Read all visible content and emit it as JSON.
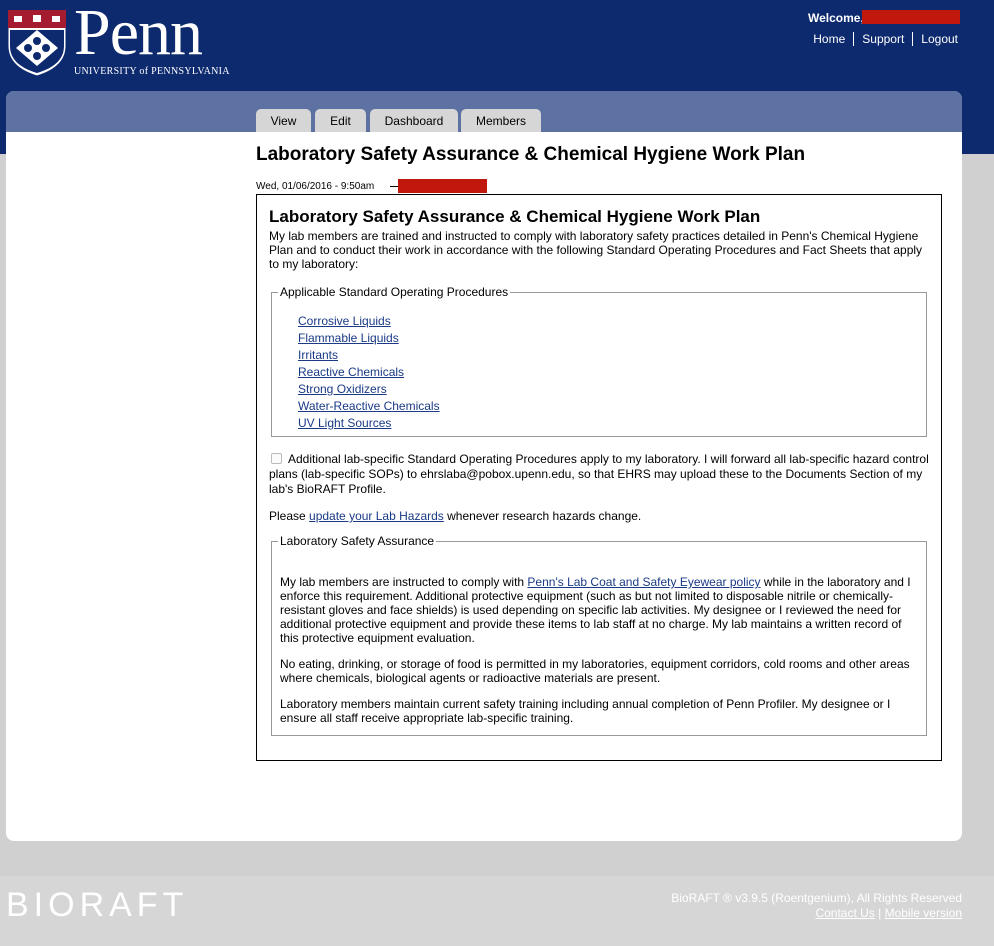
{
  "header": {
    "logo_text": "Penn",
    "logo_subtitle": "UNIVERSITY of PENNSYLVANIA",
    "welcome": "Welcome,",
    "links": [
      "Home",
      "Support",
      "Logout"
    ]
  },
  "tabs": [
    "View",
    "Edit",
    "Dashboard",
    "Members"
  ],
  "page_title": "Laboratory Safety Assurance & Chemical Hygiene Work Plan",
  "meta_date": "Wed, 01/06/2016 - 9:50am",
  "content": {
    "title": "Laboratory Safety Assurance & Chemical Hygiene Work Plan",
    "intro": "My lab members are trained and instructed to comply with laboratory safety practices detailed in Penn's Chemical Hygiene Plan and to conduct their work in accordance with the following Standard Operating Procedures and Fact Sheets that apply to my laboratory:",
    "sop_legend": "Applicable Standard Operating Procedures",
    "sop_items": [
      "Corrosive Liquids",
      "Flammable Liquids",
      "Irritants",
      "Reactive Chemicals",
      "Strong Oxidizers",
      "Water-Reactive Chemicals",
      "UV Light Sources"
    ],
    "additional_sop_checked": false,
    "additional_sop_text": "Additional lab-specific Standard Operating Procedures apply to my laboratory. I will forward all lab-specific hazard control plans (lab-specific SOPs) to ehrslaba@pobox.upenn.edu, so that EHRS may upload these to the Documents Section of my lab's BioRAFT Profile.",
    "please_prefix": "Please ",
    "please_link": "update your Lab Hazards",
    "please_suffix": " whenever research hazards change.",
    "lsa_legend": "Laboratory Safety Assurance",
    "lsa_p1_prefix": "My lab members are instructed to comply with ",
    "lsa_p1_link": "Penn's Lab Coat and Safety Eyewear policy",
    "lsa_p1_suffix": " while in the laboratory and I enforce this requirement. Additional protective equipment (such as but not limited to disposable nitrile or chemically-resistant gloves and face shields) is used depending on specific lab activities. My designee or I reviewed the need for additional protective equipment and provide these items to lab staff at no charge. My lab maintains a written record of this protective equipment evaluation.",
    "lsa_p2": "No eating, drinking, or storage of food is permitted in my laboratories, equipment corridors, cold rooms and other areas where chemicals, biological agents or radioactive materials are present.",
    "lsa_p3": "Laboratory members maintain current safety training including annual completion of Penn Profiler. My designee or I ensure all staff receive appropriate lab-specific training."
  },
  "footer": {
    "brand": "BIORAFT",
    "copyright": "BioRAFT ® v3.9.5 (Roentgenium), All Rights Reserved",
    "contact": "Contact Us",
    "separator": "|",
    "mobile": "Mobile version"
  },
  "colors": {
    "header_bg": "#0d2a6e",
    "tabbar_bg": "#5d72a2",
    "link": "#1a3a86",
    "redaction": "#c0180c",
    "page_bg": "#d0d0d0"
  }
}
